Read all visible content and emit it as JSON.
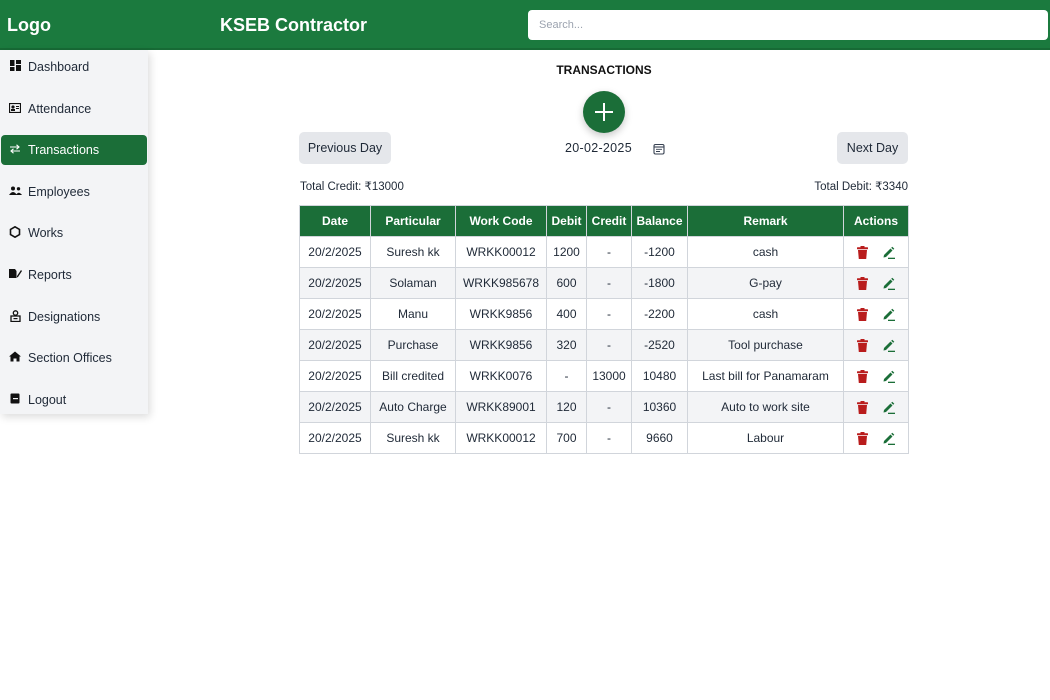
{
  "header": {
    "logo": "Logo",
    "title": "KSEB Contractor",
    "search_placeholder": "Search...",
    "search_value": ""
  },
  "sidebar": {
    "items": [
      {
        "label": "Dashboard",
        "icon": "dashboard-icon"
      },
      {
        "label": "Attendance",
        "icon": "attendance-icon"
      },
      {
        "label": "Transactions",
        "icon": "transactions-icon",
        "active": true
      },
      {
        "label": "Employees",
        "icon": "employees-icon"
      },
      {
        "label": "Works",
        "icon": "works-icon"
      },
      {
        "label": "Reports",
        "icon": "reports-icon"
      },
      {
        "label": "Designations",
        "icon": "designations-icon"
      },
      {
        "label": "Section Offices",
        "icon": "section-offices-icon"
      },
      {
        "label": "Logout",
        "icon": "logout-icon"
      }
    ]
  },
  "main": {
    "title": "TRANSACTIONS",
    "prev_label": "Previous Day",
    "next_label": "Next Day",
    "date": "20-02-2025",
    "total_credit": "Total Credit: ₹13000",
    "total_debit": "Total Debit: ₹3340"
  },
  "table": {
    "headers": [
      "Date",
      "Particular",
      "Work Code",
      "Debit",
      "Credit",
      "Balance",
      "Remark",
      "Actions"
    ],
    "rows": [
      [
        "20/2/2025",
        "Suresh kk",
        "WRKK00012",
        "1200",
        "-",
        "-1200",
        "cash"
      ],
      [
        "20/2/2025",
        "Solaman",
        "WRKK985678",
        "600",
        "-",
        "-1800",
        "G-pay"
      ],
      [
        "20/2/2025",
        "Manu",
        "WRKK9856",
        "400",
        "-",
        "-2200",
        "cash"
      ],
      [
        "20/2/2025",
        "Purchase",
        "WRKK9856",
        "320",
        "-",
        "-2520",
        "Tool purchase"
      ],
      [
        "20/2/2025",
        "Bill credited",
        "WRKK0076",
        "-",
        "13000",
        "10480",
        "Last bill for Panamaram"
      ],
      [
        "20/2/2025",
        "Auto Charge",
        "WRKK89001",
        "120",
        "-",
        "10360",
        "Auto to work site"
      ],
      [
        "20/2/2025",
        "Suresh kk",
        "WRKK00012",
        "700",
        "-",
        "9660",
        "Labour"
      ]
    ]
  },
  "colors": {
    "primary": "#1b6e38",
    "header_bg": "#1b7a3e",
    "delete": "#b91c1c",
    "edit": "#1b6e38"
  }
}
